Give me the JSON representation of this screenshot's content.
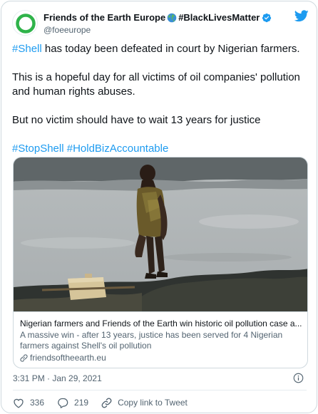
{
  "author": {
    "display_name": "Friends of the Earth Europe",
    "globe_emoji": "🌍",
    "display_name_suffix": "#BlackLivesMatter",
    "handle": "@foeeurope",
    "verified": true,
    "avatar_ring_color": "#2fb34a"
  },
  "tweet": {
    "line1_hashtag": "#Shell",
    "line1_text": " has today been defeated in court by Nigerian farmers.",
    "para2": "This is a hopeful day for all victims of oil companies' pollution and human rights abuses.",
    "para3": "But no victim should have to wait 13 years for justice",
    "hashtags": [
      "#StopShell",
      "#HoldBizAccountable"
    ]
  },
  "link_card": {
    "title": "Nigerian farmers and Friends of the Earth win historic oil pollution case a...",
    "description": "A massive win - after 13 years, justice has been served for 4 Nigerian farmers against Shell's oil pollution",
    "domain": "friendsoftheearth.eu"
  },
  "timestamp": "3:31 PM · Jan 29, 2021",
  "actions": {
    "likes": "336",
    "replies": "219",
    "copy_link_label": "Copy link to Tweet"
  },
  "colors": {
    "link_blue": "#1d9bf0",
    "twitter_blue": "#1d9bf0",
    "muted_text": "#536471",
    "border": "#cfd9de"
  }
}
